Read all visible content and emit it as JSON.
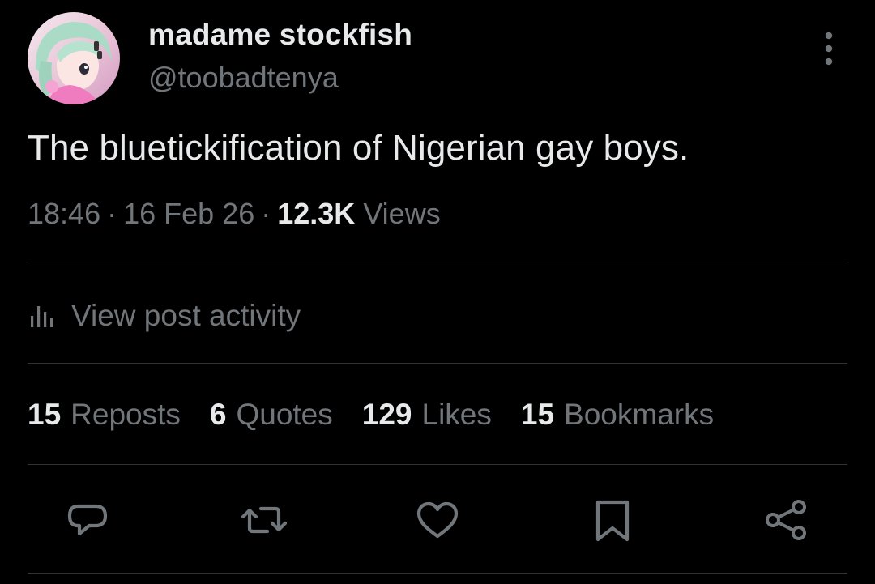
{
  "author": {
    "display_name": "madame stockfish",
    "handle": "@toobadtenya",
    "avatar_icon": "anime-avatar"
  },
  "post": {
    "text": "The bluetickification of Nigerian gay boys.",
    "time": "18:46",
    "date": "16 Feb 26",
    "separator": "·",
    "views_count": "12.3K",
    "views_label": "Views"
  },
  "activity": {
    "label": "View post activity",
    "icon": "bar-chart-icon"
  },
  "stats": {
    "reposts": {
      "count": "15",
      "label": "Reposts"
    },
    "quotes": {
      "count": "6",
      "label": "Quotes"
    },
    "likes": {
      "count": "129",
      "label": "Likes"
    },
    "bookmarks": {
      "count": "15",
      "label": "Bookmarks"
    }
  },
  "actions": [
    "reply-icon",
    "repost-icon",
    "like-icon",
    "bookmark-icon",
    "share-icon"
  ],
  "colors": {
    "background": "#000000",
    "primary_text": "#e7e9ea",
    "secondary_text": "#71767b",
    "divider": "#2f3336"
  }
}
